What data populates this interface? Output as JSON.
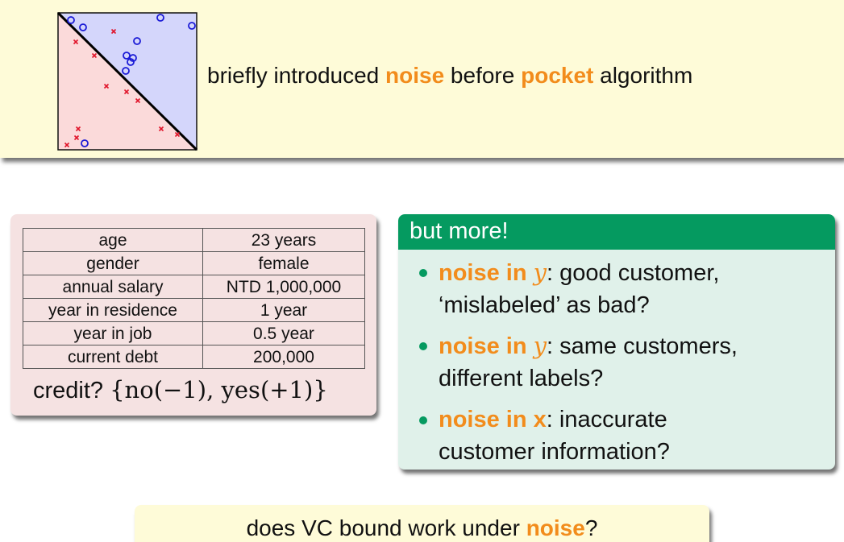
{
  "colors": {
    "highlight": "#f28c1c",
    "blue_region": "#d4d6fb",
    "red_region": "#fbdada",
    "header_green": "#059a60"
  },
  "figure": {
    "icon": "noisy-linear-classification-plot",
    "positive_marker": "circle",
    "negative_marker": "cross"
  },
  "intro": {
    "part1": "briefly introduced ",
    "kw1": "noise",
    "part2": " before ",
    "kw2": "pocket",
    "part3": " algorithm"
  },
  "credit_table": {
    "rows": [
      [
        "age",
        "23 years"
      ],
      [
        "gender",
        "female"
      ],
      [
        "annual salary",
        "NTD 1,000,000"
      ],
      [
        "year in residence",
        "1 year"
      ],
      [
        "year in job",
        "0.5 year"
      ],
      [
        "current debt",
        "200,000"
      ]
    ],
    "question": "credit? ",
    "answer_set": "{no(−1), yes(+1)}"
  },
  "more": {
    "title": "but more!",
    "bullets": [
      {
        "kw": "noise in ",
        "var": "y",
        "text": ": good customer,",
        "line2": "‘mislabeled’ as bad?"
      },
      {
        "kw": "noise in ",
        "var": "y",
        "text": ": same customers,",
        "line2": "different labels?"
      },
      {
        "kw": "noise in ",
        "var": "x",
        "text": ": inaccurate",
        "line2": "customer information?"
      }
    ]
  },
  "question": {
    "part1": "does VC bound work under ",
    "kw": "noise",
    "part2": "?"
  }
}
